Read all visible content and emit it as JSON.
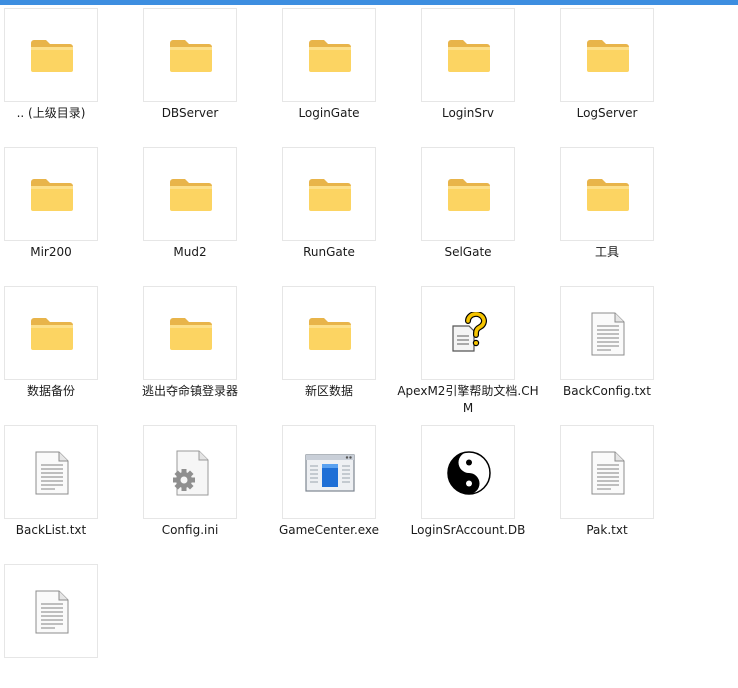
{
  "window": {
    "accent_color": "#3d8ee0"
  },
  "items": [
    {
      "label": ".. (上级目录)",
      "icon": "folder-icon"
    },
    {
      "label": "DBServer",
      "icon": "folder-icon"
    },
    {
      "label": "LoginGate",
      "icon": "folder-icon"
    },
    {
      "label": "LoginSrv",
      "icon": "folder-icon"
    },
    {
      "label": "LogServer",
      "icon": "folder-icon"
    },
    {
      "label": "Mir200",
      "icon": "folder-icon"
    },
    {
      "label": "Mud2",
      "icon": "folder-icon"
    },
    {
      "label": "RunGate",
      "icon": "folder-icon"
    },
    {
      "label": "SelGate",
      "icon": "folder-icon"
    },
    {
      "label": "工具",
      "icon": "folder-icon"
    },
    {
      "label": "数据备份",
      "icon": "folder-icon"
    },
    {
      "label": "逃出夺命镇登录器",
      "icon": "folder-icon"
    },
    {
      "label": "新区数据",
      "icon": "folder-icon"
    },
    {
      "label": "ApexM2引擎帮助文档.CHM",
      "icon": "help-file-icon"
    },
    {
      "label": "BackConfig.txt",
      "icon": "text-file-icon"
    },
    {
      "label": "BackList.txt",
      "icon": "text-file-icon"
    },
    {
      "label": "Config.ini",
      "icon": "settings-file-icon"
    },
    {
      "label": "GameCenter.exe",
      "icon": "app-window-icon"
    },
    {
      "label": "LoginSrAccount.DB",
      "icon": "yin-yang-icon"
    },
    {
      "label": "Pak.txt",
      "icon": "text-file-icon"
    },
    {
      "label": "",
      "icon": "text-file-icon"
    }
  ]
}
